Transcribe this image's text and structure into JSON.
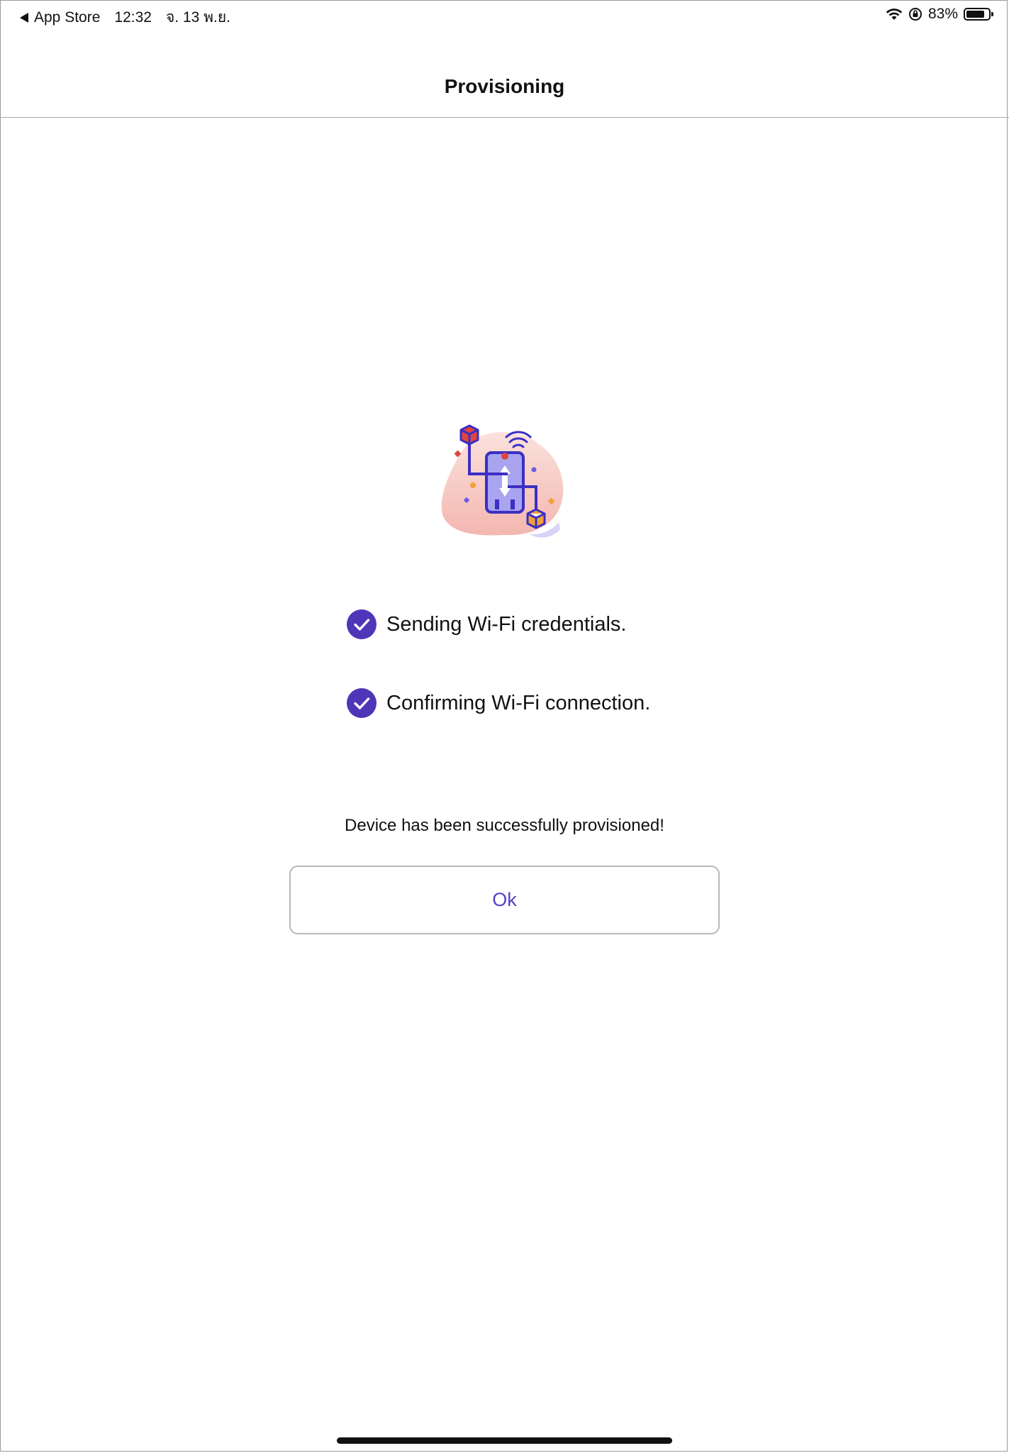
{
  "status_bar": {
    "back_app": "App Store",
    "time": "12:32",
    "date": "จ. 13 พ.ย.",
    "battery_percent_text": "83%",
    "battery_level": 0.83,
    "icons": [
      "back-caret-icon",
      "wifi-icon",
      "orientation-lock-icon",
      "battery-icon"
    ]
  },
  "nav": {
    "title": "Provisioning"
  },
  "illustration": {
    "icon": "device-provisioning-illustration",
    "colors": {
      "primary": "#3b2fc4",
      "accent": "#e0443f",
      "blob": "#f6c9c4",
      "phone_fill": "#a9a4f0",
      "orange": "#f2a13a"
    }
  },
  "steps": [
    {
      "label": "Sending Wi-Fi credentials.",
      "done": true,
      "icon": "check-circle-icon"
    },
    {
      "label": "Confirming Wi-Fi connection.",
      "done": true,
      "icon": "check-circle-icon"
    }
  ],
  "result": {
    "message": "Device has been successfully provisioned!",
    "ok_label": "Ok"
  },
  "colors": {
    "accent": "#5a3ec8",
    "check": "#4f35b8",
    "border": "#b8b8b8"
  }
}
